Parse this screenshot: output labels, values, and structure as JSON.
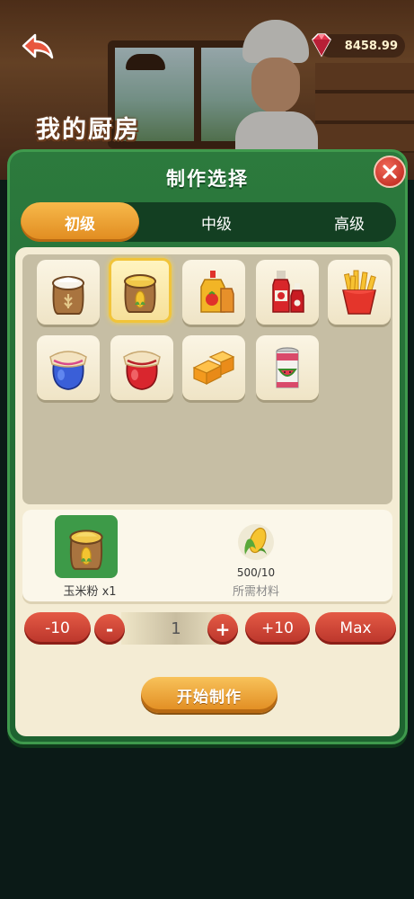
{
  "header": {
    "kitchen_title": "我的厨房",
    "gem_balance": "8458.99",
    "gem_icon": "ruby-gem-icon",
    "back_icon": "back-arrow-icon"
  },
  "dialog": {
    "title": "制作选择",
    "close_icon": "close-icon",
    "tabs": [
      {
        "label": "初级",
        "active": true
      },
      {
        "label": "中级",
        "active": false
      },
      {
        "label": "高级",
        "active": false
      }
    ],
    "items": [
      {
        "icon": "flour-sack-icon",
        "selected": false
      },
      {
        "icon": "cornmeal-sack-icon",
        "selected": true
      },
      {
        "icon": "mustard-tomato-bottles-icon",
        "selected": false
      },
      {
        "icon": "ketchup-bottles-icon",
        "selected": false
      },
      {
        "icon": "french-fries-icon",
        "selected": false
      },
      {
        "icon": "blueberry-jam-jar-icon",
        "selected": false
      },
      {
        "icon": "strawberry-jam-jar-icon",
        "selected": false
      },
      {
        "icon": "cheese-blocks-icon",
        "selected": false
      },
      {
        "icon": "watermelon-can-icon",
        "selected": false
      }
    ],
    "product": {
      "icon": "cornmeal-sack-icon",
      "name": "玉米粉 x1"
    },
    "material": {
      "icon": "corn-icon",
      "count": "500/10",
      "label": "所需材料"
    },
    "controls": {
      "minus10": "-10",
      "minus": "-",
      "quantity": "1",
      "plus": "+",
      "plus10": "+10",
      "max": "Max"
    },
    "start_button": "开始制作"
  },
  "colors": {
    "panel_green": "#2c7a3d",
    "tab_orange": "#e08a1f",
    "button_red": "#c8352a",
    "cream": "#f4ecd4"
  }
}
